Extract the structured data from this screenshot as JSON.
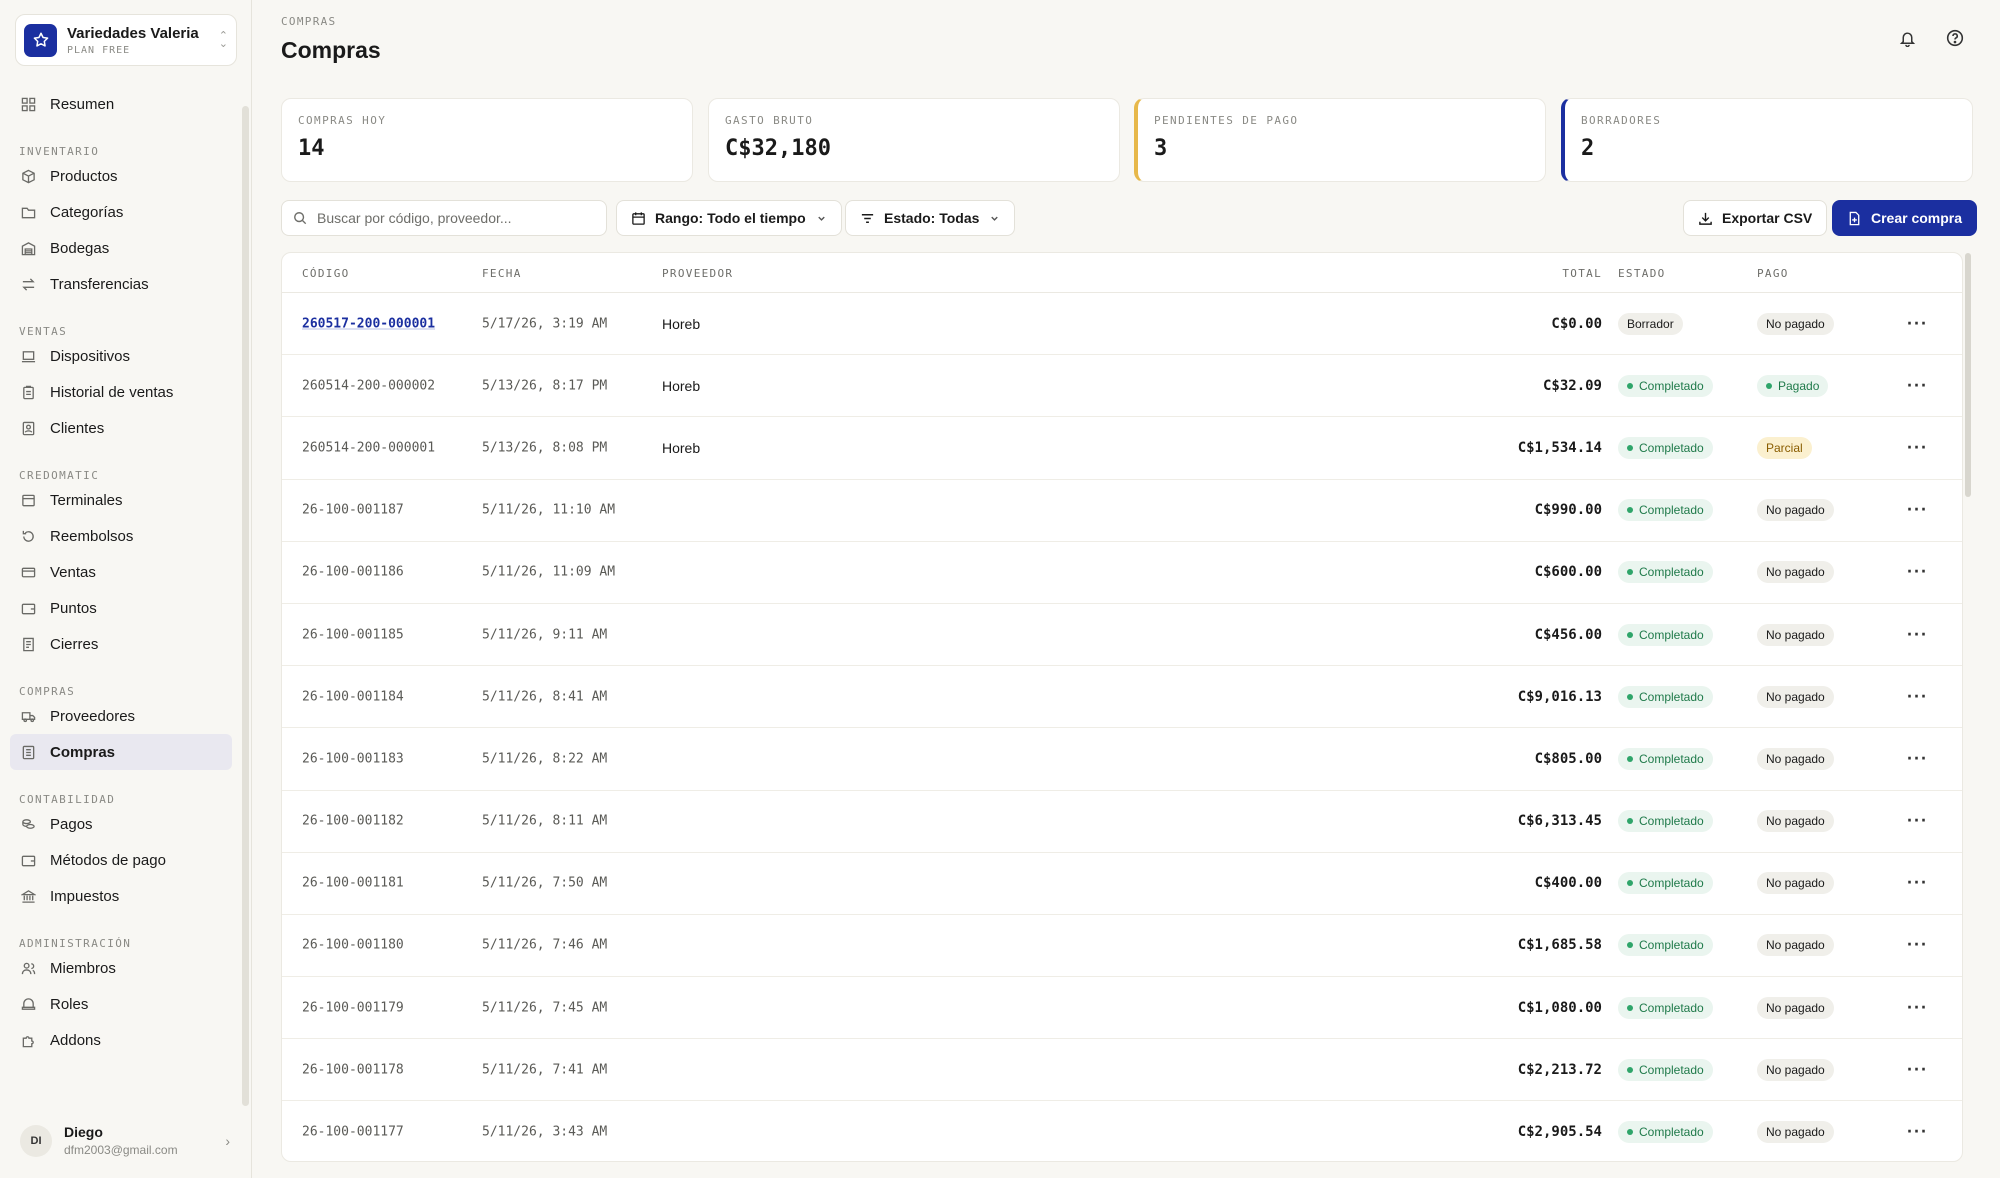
{
  "colors": {
    "accent": "#1b2fa0",
    "warning": "#e7b84a",
    "success": "#2fa56a"
  },
  "org": {
    "name": "Variedades Valeria",
    "plan": "PLAN FREE",
    "icon": "star-icon"
  },
  "nav": {
    "top": {
      "label": "Resumen",
      "icon": "grid-icon"
    },
    "sections": [
      {
        "title": "INVENTARIO",
        "items": [
          {
            "label": "Productos",
            "icon": "box-icon"
          },
          {
            "label": "Categorías",
            "icon": "folder-icon"
          },
          {
            "label": "Bodegas",
            "icon": "warehouse-icon"
          },
          {
            "label": "Transferencias",
            "icon": "arrows-icon"
          }
        ]
      },
      {
        "title": "VENTAS",
        "items": [
          {
            "label": "Dispositivos",
            "icon": "laptop-icon"
          },
          {
            "label": "Historial de ventas",
            "icon": "clipboard-icon"
          },
          {
            "label": "Clientes",
            "icon": "contact-icon"
          }
        ]
      },
      {
        "title": "CREDOMATIC",
        "items": [
          {
            "label": "Terminales",
            "icon": "terminal-icon"
          },
          {
            "label": "Reembolsos",
            "icon": "refund-icon"
          },
          {
            "label": "Ventas",
            "icon": "card-icon"
          },
          {
            "label": "Puntos",
            "icon": "wallet-icon"
          },
          {
            "label": "Cierres",
            "icon": "receipt-icon"
          }
        ]
      },
      {
        "title": "COMPRAS",
        "items": [
          {
            "label": "Proveedores",
            "icon": "truck-icon"
          },
          {
            "label": "Compras",
            "icon": "document-icon",
            "active": true
          }
        ]
      },
      {
        "title": "CONTABILIDAD",
        "items": [
          {
            "label": "Pagos",
            "icon": "coins-icon"
          },
          {
            "label": "Métodos de pago",
            "icon": "wallet-icon"
          },
          {
            "label": "Impuestos",
            "icon": "bank-icon"
          }
        ]
      },
      {
        "title": "ADMINISTRACIÓN",
        "items": [
          {
            "label": "Miembros",
            "icon": "users-icon"
          },
          {
            "label": "Roles",
            "icon": "hat-icon"
          },
          {
            "label": "Addons",
            "icon": "puzzle-icon"
          }
        ]
      }
    ]
  },
  "user": {
    "initials": "DI",
    "name": "Diego",
    "email": "dfm2003@gmail.com"
  },
  "header": {
    "eyebrow": "COMPRAS",
    "title": "Compras"
  },
  "stats": [
    {
      "label": "COMPRAS HOY",
      "value": "14"
    },
    {
      "label": "GASTO BRUTO",
      "value": "C$32,180"
    },
    {
      "label": "PENDIENTES DE PAGO",
      "value": "3"
    },
    {
      "label": "BORRADORES",
      "value": "2"
    }
  ],
  "toolbar": {
    "search_placeholder": "Buscar por código, proveedor...",
    "range_label": "Rango: Todo el tiempo",
    "status_label": "Estado: Todas",
    "export_label": "Exportar CSV",
    "create_label": "Crear compra"
  },
  "table": {
    "columns": [
      "CÓDIGO",
      "FECHA",
      "PROVEEDOR",
      "TOTAL",
      "ESTADO",
      "PAGO"
    ],
    "rows": [
      {
        "code": "260517-200-000001",
        "date": "5/17/26, 3:19 AM",
        "provider": "Horeb",
        "total": "C$0.00",
        "status": "Borrador",
        "payment": "No pagado"
      },
      {
        "code": "260514-200-000002",
        "date": "5/13/26, 8:17 PM",
        "provider": "Horeb",
        "total": "C$32.09",
        "status": "Completado",
        "payment": "Pagado"
      },
      {
        "code": "260514-200-000001",
        "date": "5/13/26, 8:08 PM",
        "provider": "Horeb",
        "total": "C$1,534.14",
        "status": "Completado",
        "payment": "Parcial"
      },
      {
        "code": "26-100-001187",
        "date": "5/11/26, 11:10 AM",
        "provider": "",
        "total": "C$990.00",
        "status": "Completado",
        "payment": "No pagado"
      },
      {
        "code": "26-100-001186",
        "date": "5/11/26, 11:09 AM",
        "provider": "",
        "total": "C$600.00",
        "status": "Completado",
        "payment": "No pagado"
      },
      {
        "code": "26-100-001185",
        "date": "5/11/26, 9:11 AM",
        "provider": "",
        "total": "C$456.00",
        "status": "Completado",
        "payment": "No pagado"
      },
      {
        "code": "26-100-001184",
        "date": "5/11/26, 8:41 AM",
        "provider": "",
        "total": "C$9,016.13",
        "status": "Completado",
        "payment": "No pagado"
      },
      {
        "code": "26-100-001183",
        "date": "5/11/26, 8:22 AM",
        "provider": "",
        "total": "C$805.00",
        "status": "Completado",
        "payment": "No pagado"
      },
      {
        "code": "26-100-001182",
        "date": "5/11/26, 8:11 AM",
        "provider": "",
        "total": "C$6,313.45",
        "status": "Completado",
        "payment": "No pagado"
      },
      {
        "code": "26-100-001181",
        "date": "5/11/26, 7:50 AM",
        "provider": "",
        "total": "C$400.00",
        "status": "Completado",
        "payment": "No pagado"
      },
      {
        "code": "26-100-001180",
        "date": "5/11/26, 7:46 AM",
        "provider": "",
        "total": "C$1,685.58",
        "status": "Completado",
        "payment": "No pagado"
      },
      {
        "code": "26-100-001179",
        "date": "5/11/26, 7:45 AM",
        "provider": "",
        "total": "C$1,080.00",
        "status": "Completado",
        "payment": "No pagado"
      },
      {
        "code": "26-100-001178",
        "date": "5/11/26, 7:41 AM",
        "provider": "",
        "total": "C$2,213.72",
        "status": "Completado",
        "payment": "No pagado"
      },
      {
        "code": "26-100-001177",
        "date": "5/11/26, 3:43 AM",
        "provider": "",
        "total": "C$2,905.54",
        "status": "Completado",
        "payment": "No pagado"
      }
    ]
  }
}
